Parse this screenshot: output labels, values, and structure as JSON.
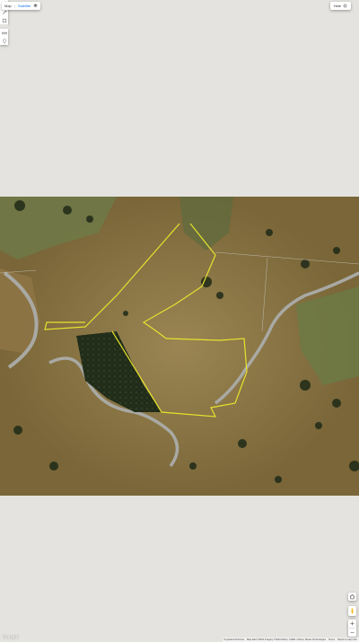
{
  "map_type": {
    "map_label": "Map",
    "satellite_label": "Satellite",
    "active": "satellite"
  },
  "fullscreen": {
    "label": "Hide"
  },
  "draw_tools": [
    "hand-icon",
    "pencil-icon",
    "polygon-icon",
    "ruler-icon",
    "marker-icon"
  ],
  "colors": {
    "parcel_outline": "#e6e22e",
    "lot_boundaries": "#d9d9d9",
    "pasture": "#7d6a3e",
    "forest": "#1f2a18",
    "river": "#a9a9a4",
    "background": "#e5e3df"
  },
  "right_controls": [
    "home-icon",
    "pegman-icon"
  ],
  "zoom": {
    "in": "+",
    "out": "−"
  },
  "logo": "Google",
  "attribution": {
    "shortcuts": "Keyboard shortcuts",
    "data": "Map data ©2023 Imagery ©2023 Airbus, CNES / Airbus, Maxar Technologies",
    "terms": "Terms",
    "report": "Report a map error"
  }
}
